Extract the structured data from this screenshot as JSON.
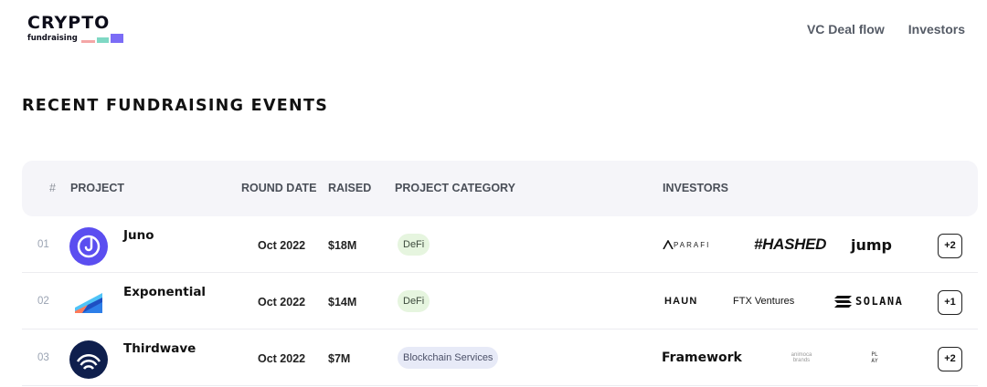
{
  "brand": {
    "title": "CRYPTO",
    "subtitle": "fundraising",
    "bar_colors": [
      "#f4a6a6",
      "#7fd8c4",
      "#7b6cf6"
    ]
  },
  "nav": {
    "deal_flow": "VC Deal flow",
    "investors": "Investors"
  },
  "section": {
    "title": "RECENT FUNDRAISING EVENTS"
  },
  "table": {
    "headers": {
      "index": "#",
      "project": "PROJECT",
      "round_date": "ROUND DATE",
      "raised": "RAISED",
      "category": "PROJECT CATEGORY",
      "investors": "INVESTORS"
    },
    "rows": [
      {
        "index": "01",
        "project": "Juno",
        "round_date": "Oct 2022",
        "raised": "$18M",
        "category": "DeFi",
        "investors": [
          "PARAFI",
          "#HASHED",
          "jump"
        ],
        "more": "+2"
      },
      {
        "index": "02",
        "project": "Exponential",
        "round_date": "Oct 2022",
        "raised": "$14M",
        "category": "DeFi",
        "investors": [
          "HAUN",
          "FTX Ventures",
          "SOLANA"
        ],
        "more": "+1"
      },
      {
        "index": "03",
        "project": "Thirdwave",
        "round_date": "Oct 2022",
        "raised": "$7M",
        "category": "Blockchain Services",
        "investors": [
          "Framework",
          "animoca brands",
          "PL AY"
        ],
        "more": "+2"
      }
    ]
  },
  "colors": {
    "header_bg": "#f5f5f9",
    "defi_tag": "#e6f5df",
    "chain_tag": "#e7eaf7",
    "juno_logo": "#5b4ef0",
    "thirdwave_logo": "#0f1f4d"
  }
}
